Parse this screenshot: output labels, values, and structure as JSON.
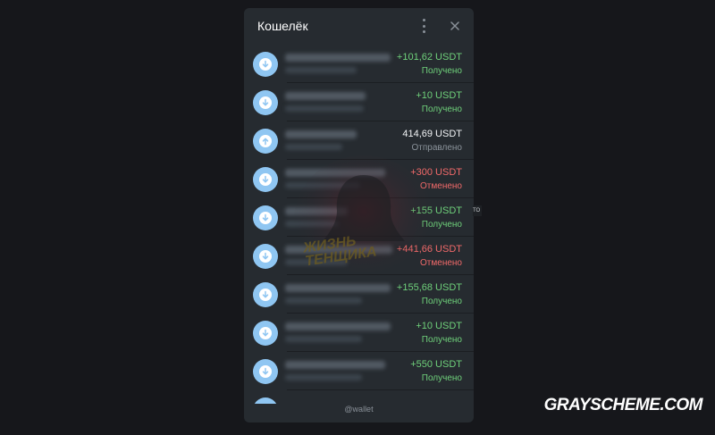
{
  "wallet": {
    "title": "Кошелёк",
    "menu_icon": "more-vertical-icon",
    "close_icon": "close-icon",
    "transactions": [
      {
        "direction": "in",
        "amount": "+101,62 USDT",
        "status": "Получено",
        "amount_color": "#6fd17b",
        "status_color": "#6fd17b"
      },
      {
        "direction": "in",
        "amount": "+10 USDT",
        "status": "Получено",
        "amount_color": "#6fd17b",
        "status_color": "#6fd17b"
      },
      {
        "direction": "out",
        "amount": "414,69 USDT",
        "status": "Отправлено",
        "amount_color": "#f2f4f6",
        "status_color": "#8b939b"
      },
      {
        "direction": "in",
        "amount": "+300 USDT",
        "status": "Отменено",
        "amount_color": "#f26a6a",
        "status_color": "#f26a6a"
      },
      {
        "direction": "in",
        "amount": "+155 USDT",
        "status": "Получено",
        "amount_color": "#6fd17b",
        "status_color": "#6fd17b"
      },
      {
        "direction": "in",
        "amount": "+441,66 USDT",
        "status": "Отменено",
        "amount_color": "#f26a6a",
        "status_color": "#f26a6a"
      },
      {
        "direction": "in",
        "amount": "+155,68 USDT",
        "status": "Получено",
        "amount_color": "#6fd17b",
        "status_color": "#6fd17b"
      },
      {
        "direction": "in",
        "amount": "+10 USDT",
        "status": "Получено",
        "amount_color": "#6fd17b",
        "status_color": "#6fd17b"
      },
      {
        "direction": "in",
        "amount": "+550 USDT",
        "status": "Получено",
        "amount_color": "#6fd17b",
        "status_color": "#6fd17b"
      }
    ],
    "footer": "@wallet"
  },
  "overlay": {
    "watermark_text": [
      "ЖИЗНЬ",
      "ТЕНЩИКА"
    ],
    "brand": "GRAYSCHEME.COM"
  },
  "colors": {
    "background": "#16171b",
    "panel": "#262b30",
    "avatar": "#8fc6f2",
    "received": "#6fd17b",
    "canceled": "#f26a6a"
  }
}
